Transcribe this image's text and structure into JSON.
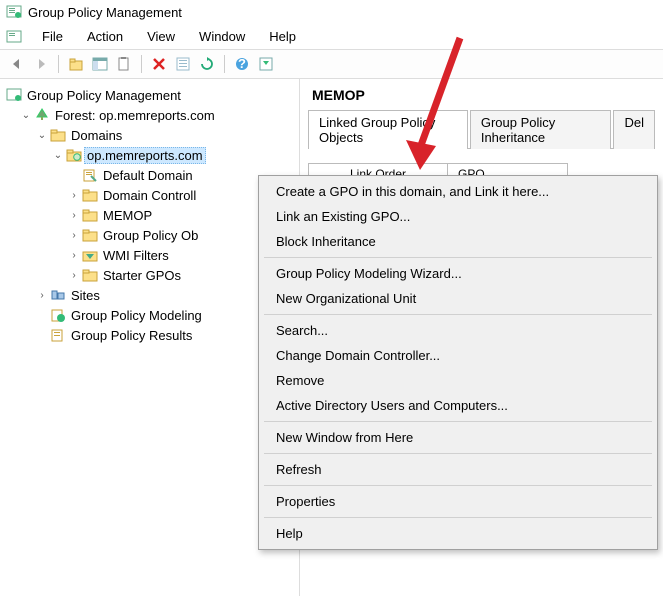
{
  "window": {
    "title": "Group Policy Management"
  },
  "menu": {
    "file": "File",
    "action": "Action",
    "view": "View",
    "window": "Window",
    "help": "Help"
  },
  "tree": {
    "root": "Group Policy Management",
    "forest": "Forest: op.memreports.com",
    "domains": "Domains",
    "domain": "op.memreports.com",
    "defaultDomain": "Default Domain",
    "domainControllers": "Domain Controll",
    "memop": "MEMOP",
    "gpObjects": "Group Policy Ob",
    "wmiFilters": "WMI Filters",
    "starterGpos": "Starter GPOs",
    "sites": "Sites",
    "gpModeling": "Group Policy Modeling",
    "gpResults": "Group Policy Results"
  },
  "details": {
    "title": "MEMOP",
    "tab1": "Linked Group Policy Objects",
    "tab2": "Group Policy Inheritance",
    "tab3": "Del",
    "col1": "Link Order",
    "col2": "GPO"
  },
  "context": {
    "createGpo": "Create a GPO in this domain, and Link it here...",
    "linkExisting": "Link an Existing GPO...",
    "blockInherit": "Block Inheritance",
    "gpmWizard": "Group Policy Modeling Wizard...",
    "newOu": "New Organizational Unit",
    "search": "Search...",
    "changeDc": "Change Domain Controller...",
    "remove": "Remove",
    "adUsers": "Active Directory Users and Computers...",
    "newWindow": "New Window from Here",
    "refresh": "Refresh",
    "properties": "Properties",
    "help": "Help"
  }
}
